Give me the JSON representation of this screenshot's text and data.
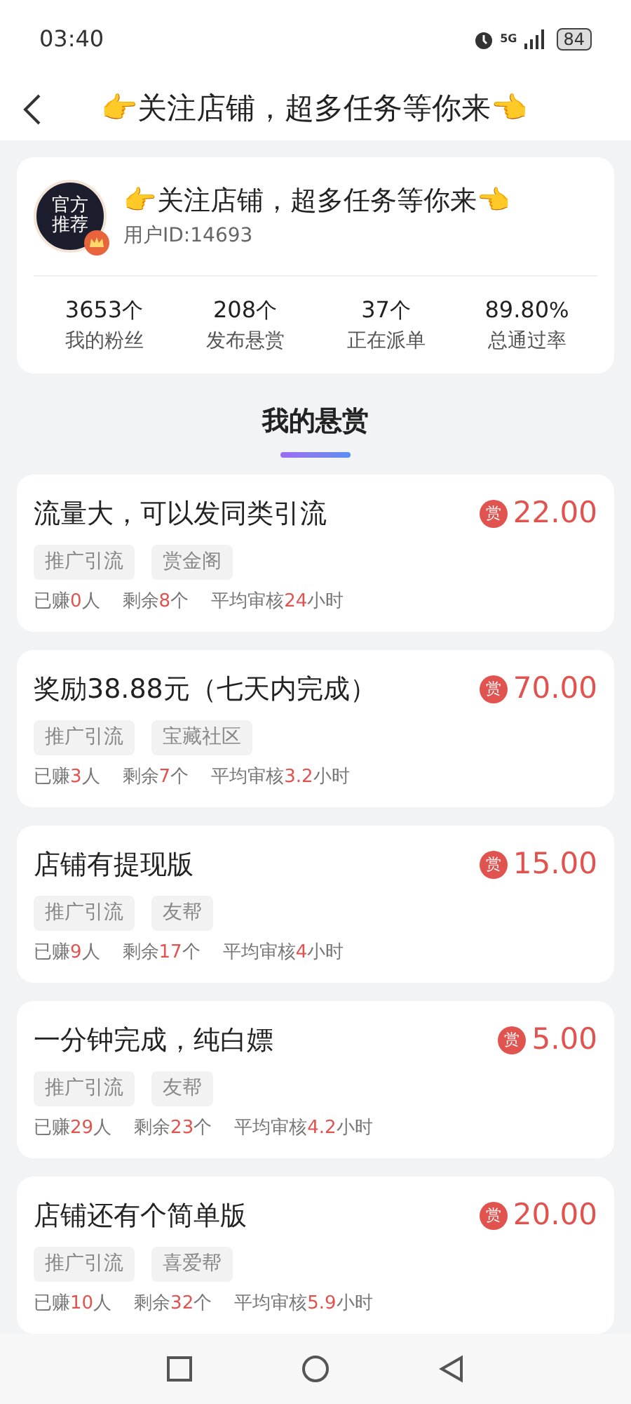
{
  "status_bar": {
    "time": "03:40",
    "network": "5G",
    "battery": "84"
  },
  "header": {
    "title": "👉关注店铺，超多任务等你来👈"
  },
  "profile": {
    "avatar_text": "官方推荐",
    "name": "👉关注店铺，超多任务等你来👈",
    "user_id": "用户ID:14693",
    "stats": [
      {
        "value": "3653",
        "unit": "个",
        "label": "我的粉丝"
      },
      {
        "value": "208",
        "unit": "个",
        "label": "发布悬赏"
      },
      {
        "value": "37",
        "unit": "个",
        "label": "正在派单"
      },
      {
        "value": "89.80",
        "unit": "%",
        "label": "总通过率"
      }
    ]
  },
  "section_tab": {
    "label": "我的悬赏",
    "selected": true
  },
  "tasks": [
    {
      "title": "流量大，可以发同类引流",
      "badge": "赏",
      "price": "22.00",
      "tags": [
        "推广引流",
        "赏金阁"
      ],
      "stats": [
        [
          "已赚",
          "0",
          "人"
        ],
        [
          "剩余",
          "8",
          "个"
        ],
        [
          "平均审核",
          "24",
          "小时"
        ]
      ]
    },
    {
      "title": "奖励38.88元（七天内完成）",
      "badge": "赏",
      "price": "70.00",
      "tags": [
        "推广引流",
        "宝藏社区"
      ],
      "stats": [
        [
          "已赚",
          "3",
          "人"
        ],
        [
          "剩余",
          "7",
          "个"
        ],
        [
          "平均审核",
          "3.2",
          "小时"
        ]
      ]
    },
    {
      "title": "店铺有提现版",
      "badge": "赏",
      "price": "15.00",
      "tags": [
        "推广引流",
        "友帮"
      ],
      "stats": [
        [
          "已赚",
          "9",
          "人"
        ],
        [
          "剩余",
          "17",
          "个"
        ],
        [
          "平均审核",
          "4",
          "小时"
        ]
      ]
    },
    {
      "title": "一分钟完成，纯白嫖",
      "badge": "赏",
      "price": "5.00",
      "tags": [
        "推广引流",
        "友帮"
      ],
      "stats": [
        [
          "已赚",
          "29",
          "人"
        ],
        [
          "剩余",
          "23",
          "个"
        ],
        [
          "平均审核",
          "4.2",
          "小时"
        ]
      ]
    },
    {
      "title": "店铺还有个简单版",
      "badge": "赏",
      "price": "20.00",
      "tags": [
        "推广引流",
        "喜爱帮"
      ],
      "stats": [
        [
          "已赚",
          "10",
          "人"
        ],
        [
          "剩余",
          "32",
          "个"
        ],
        [
          "平均审核",
          "5.9",
          "小时"
        ]
      ]
    }
  ]
}
